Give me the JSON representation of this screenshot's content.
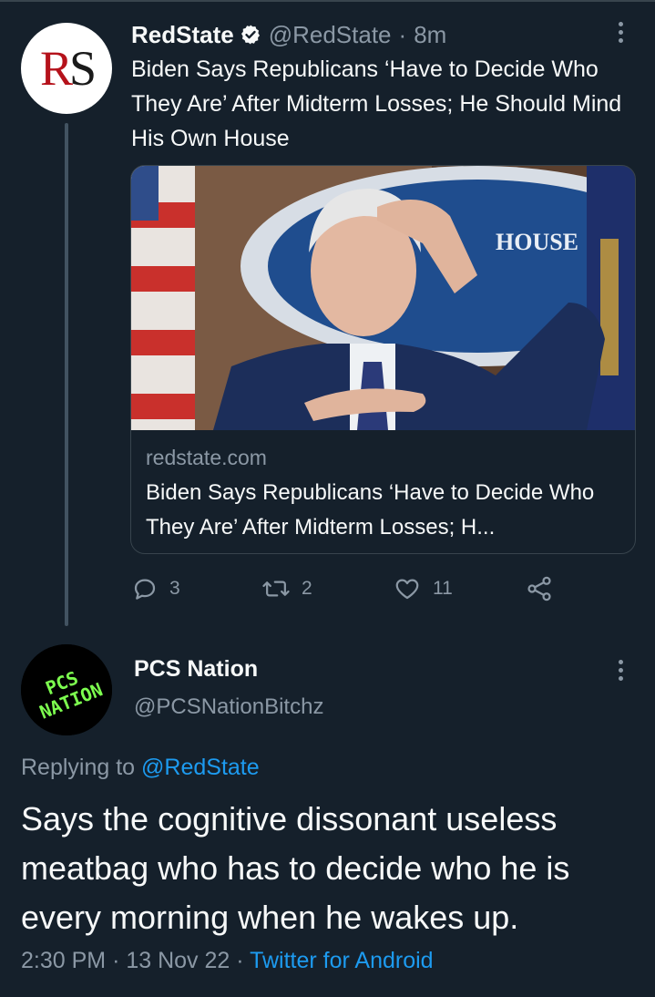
{
  "parent_tweet": {
    "avatar_text_r": "R",
    "avatar_text_s": "S",
    "display_name": "RedState",
    "handle": "@RedState",
    "separator": "·",
    "time": "8m",
    "text": "Biden Says Republicans ‘Have to Decide Who They Are’ After Midterm Losses; He Should Mind His Own House",
    "card": {
      "domain": "redstate.com",
      "title": "Biden Says Republicans ‘Have to Decide Who They Are’ After Midterm Losses; H...",
      "image_text": "HOUSE"
    },
    "actions": {
      "reply_count": "3",
      "retweet_count": "2",
      "like_count": "11"
    }
  },
  "reply_tweet": {
    "avatar_text_line1": "PCS",
    "avatar_text_line2": "NATION",
    "display_name": "PCS Nation",
    "handle": "@PCSNationBitchz",
    "replying_prefix": "Replying to",
    "replying_to": "@RedState",
    "text": "Says the cognitive dissonant useless meatbag who has to decide who he is every morning when he wakes up.",
    "time": "2:30 PM",
    "date": "13 Nov 22",
    "source": "Twitter for Android",
    "separator": "·"
  },
  "colors": {
    "background": "#15202b",
    "primary_text": "#f7f9f9",
    "secondary_text": "#8b98a5",
    "link": "#1d9bf0",
    "border": "#38444d",
    "rs_red": "#b5121b",
    "pcs_green": "#7dff4f"
  }
}
